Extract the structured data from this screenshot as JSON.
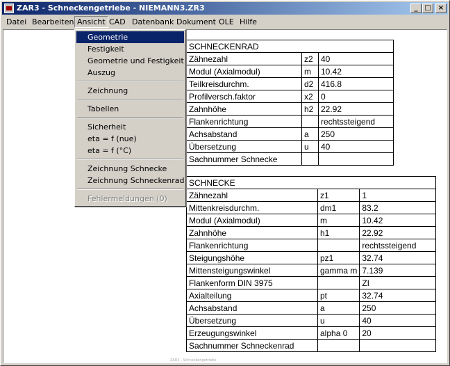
{
  "title": "ZAR3 - Schneckengetriebe  -  NIEMANN3.ZR3",
  "window_controls": {
    "minimize": "_",
    "maximize": "□",
    "close": "×"
  },
  "menubar": [
    "Datei",
    "Bearbeiten",
    "Ansicht",
    "CAD",
    "Datenbank",
    "Dokument",
    "OLE",
    "Hilfe"
  ],
  "dropdown": {
    "groups": [
      [
        "Geometrie",
        "Festigkeit",
        "Geometrie und Festigkeit",
        "Auszug"
      ],
      [
        "Zeichnung"
      ],
      [
        "Tabellen"
      ],
      [
        "Sicherheit",
        "eta = f (nue)",
        "eta = f (°C)"
      ],
      [
        "Zeichnung Schnecke",
        "Zeichnung Schneckenrad"
      ],
      [
        "Fehlermeldungen (0)"
      ]
    ],
    "selected": "Geometrie",
    "disabled": "Fehlermeldungen (0)"
  },
  "schneckenrad": {
    "header": "SCHNECKENRAD",
    "rows": [
      [
        "Zähnezahl",
        "z2",
        "40"
      ],
      [
        "Modul (Axialmodul)",
        "m",
        "10.42"
      ],
      [
        "Teilkreisdurchm.",
        "d2",
        "416.8"
      ],
      [
        "Profilversch.faktor",
        "x2",
        "0"
      ],
      [
        "Zahnhöhe",
        "h2",
        "22.92"
      ],
      [
        "Flankenrichtung",
        "",
        "rechtssteigend"
      ],
      [
        "Achsabstand",
        "a",
        "250"
      ],
      [
        "Übersetzung",
        "u",
        "40"
      ],
      [
        "Sachnummer Schnecke",
        "",
        ""
      ]
    ]
  },
  "schnecke": {
    "header": "SCHNECKE",
    "rows": [
      [
        "Zähnezahl",
        "z1",
        "1"
      ],
      [
        "Mittenkreisdurchm.",
        "dm1",
        "83.2"
      ],
      [
        "Modul (Axialmodul)",
        "m",
        "10.42"
      ],
      [
        "Zahnhöhe",
        "h1",
        "22.92"
      ],
      [
        "Flankenrichtung",
        "",
        "rechtssteigend"
      ],
      [
        "Steigungshöhe",
        "pz1",
        "32.74"
      ],
      [
        "Mittensteigungswinkel",
        "gamma m",
        "7.139"
      ],
      [
        "Flankenform DIN 3975",
        "",
        "ZI"
      ],
      [
        "Axialteilung",
        "pt",
        "32.74"
      ],
      [
        "Achsabstand",
        "a",
        "250"
      ],
      [
        "Übersetzung",
        "u",
        "40"
      ],
      [
        "Erzeugungswinkel",
        "alpha 0",
        "20"
      ],
      [
        "Sachnummer Schneckenrad",
        "",
        ""
      ]
    ]
  },
  "footer": "ZAR3 - Schneckengetriebe"
}
